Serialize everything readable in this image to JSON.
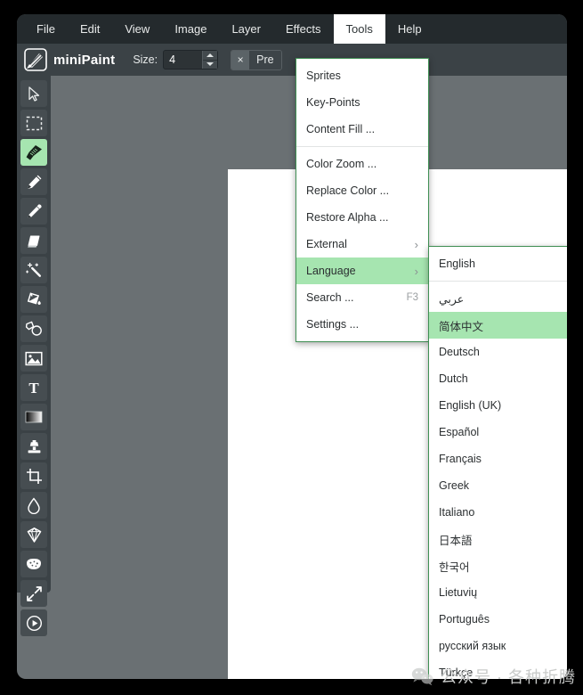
{
  "app": {
    "name": "miniPaint",
    "logo_icon": "paint-brush-logo-icon"
  },
  "menubar": {
    "items": [
      {
        "label": "File",
        "active": false
      },
      {
        "label": "Edit",
        "active": false
      },
      {
        "label": "View",
        "active": false
      },
      {
        "label": "Image",
        "active": false
      },
      {
        "label": "Layer",
        "active": false
      },
      {
        "label": "Effects",
        "active": false
      },
      {
        "label": "Tools",
        "active": true
      },
      {
        "label": "Help",
        "active": false
      }
    ]
  },
  "toolbar": {
    "size_label": "Size:",
    "size_value": "4",
    "size_placeholder": "4",
    "chip_close": "×",
    "chip_label": "Pre"
  },
  "tool_panel": {
    "tools": [
      {
        "name": "select-tool",
        "label": "Select",
        "selected": false
      },
      {
        "name": "marquee-tool",
        "label": "Marquee",
        "selected": false
      },
      {
        "name": "brush-tool",
        "label": "Brush",
        "selected": true
      },
      {
        "name": "pencil-tool",
        "label": "Pencil",
        "selected": false
      },
      {
        "name": "eyedropper-tool",
        "label": "Color Picker",
        "selected": false
      },
      {
        "name": "eraser-tool",
        "label": "Eraser",
        "selected": false
      },
      {
        "name": "magic-wand-tool",
        "label": "Magic Wand",
        "selected": false
      },
      {
        "name": "paint-bucket-tool",
        "label": "Fill",
        "selected": false
      },
      {
        "name": "shape-tool",
        "label": "Shape",
        "selected": false
      },
      {
        "name": "media-tool",
        "label": "Media",
        "selected": false
      },
      {
        "name": "text-tool",
        "label": "Text",
        "selected": false
      },
      {
        "name": "gradient-tool",
        "label": "Gradient",
        "selected": false
      },
      {
        "name": "clone-stamp-tool",
        "label": "Clone Stamp",
        "selected": false
      },
      {
        "name": "crop-tool",
        "label": "Crop",
        "selected": false
      },
      {
        "name": "blur-tool",
        "label": "Blur",
        "selected": false
      },
      {
        "name": "sharpen-tool",
        "label": "Sharpen",
        "selected": false
      },
      {
        "name": "sponge-tool",
        "label": "Sponge",
        "selected": false
      },
      {
        "name": "resize-tool",
        "label": "Resize",
        "selected": false
      },
      {
        "name": "animation-tool",
        "label": "Animation",
        "selected": false
      }
    ]
  },
  "tools_menu": {
    "open": true,
    "items": [
      {
        "label": "Sprites",
        "shortcut": "",
        "submenu": false,
        "highlight": false,
        "separator_after": false
      },
      {
        "label": "Key-Points",
        "shortcut": "",
        "submenu": false,
        "highlight": false,
        "separator_after": false
      },
      {
        "label": "Content Fill ...",
        "shortcut": "",
        "submenu": false,
        "highlight": false,
        "separator_after": true
      },
      {
        "label": "Color Zoom ...",
        "shortcut": "",
        "submenu": false,
        "highlight": false,
        "separator_after": false
      },
      {
        "label": "Replace Color ...",
        "shortcut": "",
        "submenu": false,
        "highlight": false,
        "separator_after": false
      },
      {
        "label": "Restore Alpha ...",
        "shortcut": "",
        "submenu": false,
        "highlight": false,
        "separator_after": false
      },
      {
        "label": "External",
        "shortcut": "",
        "submenu": true,
        "highlight": false,
        "separator_after": false
      },
      {
        "label": "Language",
        "shortcut": "",
        "submenu": true,
        "highlight": true,
        "separator_after": false
      },
      {
        "label": "Search ...",
        "shortcut": "F3",
        "submenu": false,
        "highlight": false,
        "separator_after": false
      },
      {
        "label": "Settings ...",
        "shortcut": "",
        "submenu": false,
        "highlight": false,
        "separator_after": false
      }
    ]
  },
  "language_menu": {
    "open": true,
    "items": [
      {
        "label": "English",
        "highlight": false,
        "separator_after": true
      },
      {
        "label": "عربي",
        "highlight": false,
        "separator_after": false
      },
      {
        "label": "简体中文",
        "highlight": true,
        "separator_after": false
      },
      {
        "label": "Deutsch",
        "highlight": false,
        "separator_after": false
      },
      {
        "label": "Dutch",
        "highlight": false,
        "separator_after": false
      },
      {
        "label": "English (UK)",
        "highlight": false,
        "separator_after": false
      },
      {
        "label": "Español",
        "highlight": false,
        "separator_after": false
      },
      {
        "label": "Français",
        "highlight": false,
        "separator_after": false
      },
      {
        "label": "Greek",
        "highlight": false,
        "separator_after": false
      },
      {
        "label": "Italiano",
        "highlight": false,
        "separator_after": false
      },
      {
        "label": "日本語",
        "highlight": false,
        "separator_after": false
      },
      {
        "label": "한국어",
        "highlight": false,
        "separator_after": false
      },
      {
        "label": "Lietuvių",
        "highlight": false,
        "separator_after": false
      },
      {
        "label": "Português",
        "highlight": false,
        "separator_after": false
      },
      {
        "label": "русский язык",
        "highlight": false,
        "separator_after": false
      },
      {
        "label": "Türkçe",
        "highlight": false,
        "separator_after": false
      }
    ]
  },
  "watermark": {
    "text": "公众号 · 各种折腾",
    "icon": "wechat-icon"
  },
  "colors": {
    "menubar_bg": "#242a2d",
    "toolbar_bg": "#3b4246",
    "canvas_bg": "#6a7073",
    "highlight_green": "#a6e5b0",
    "menu_border_green": "#3f8f53",
    "sheet_white": "#ffffff"
  }
}
